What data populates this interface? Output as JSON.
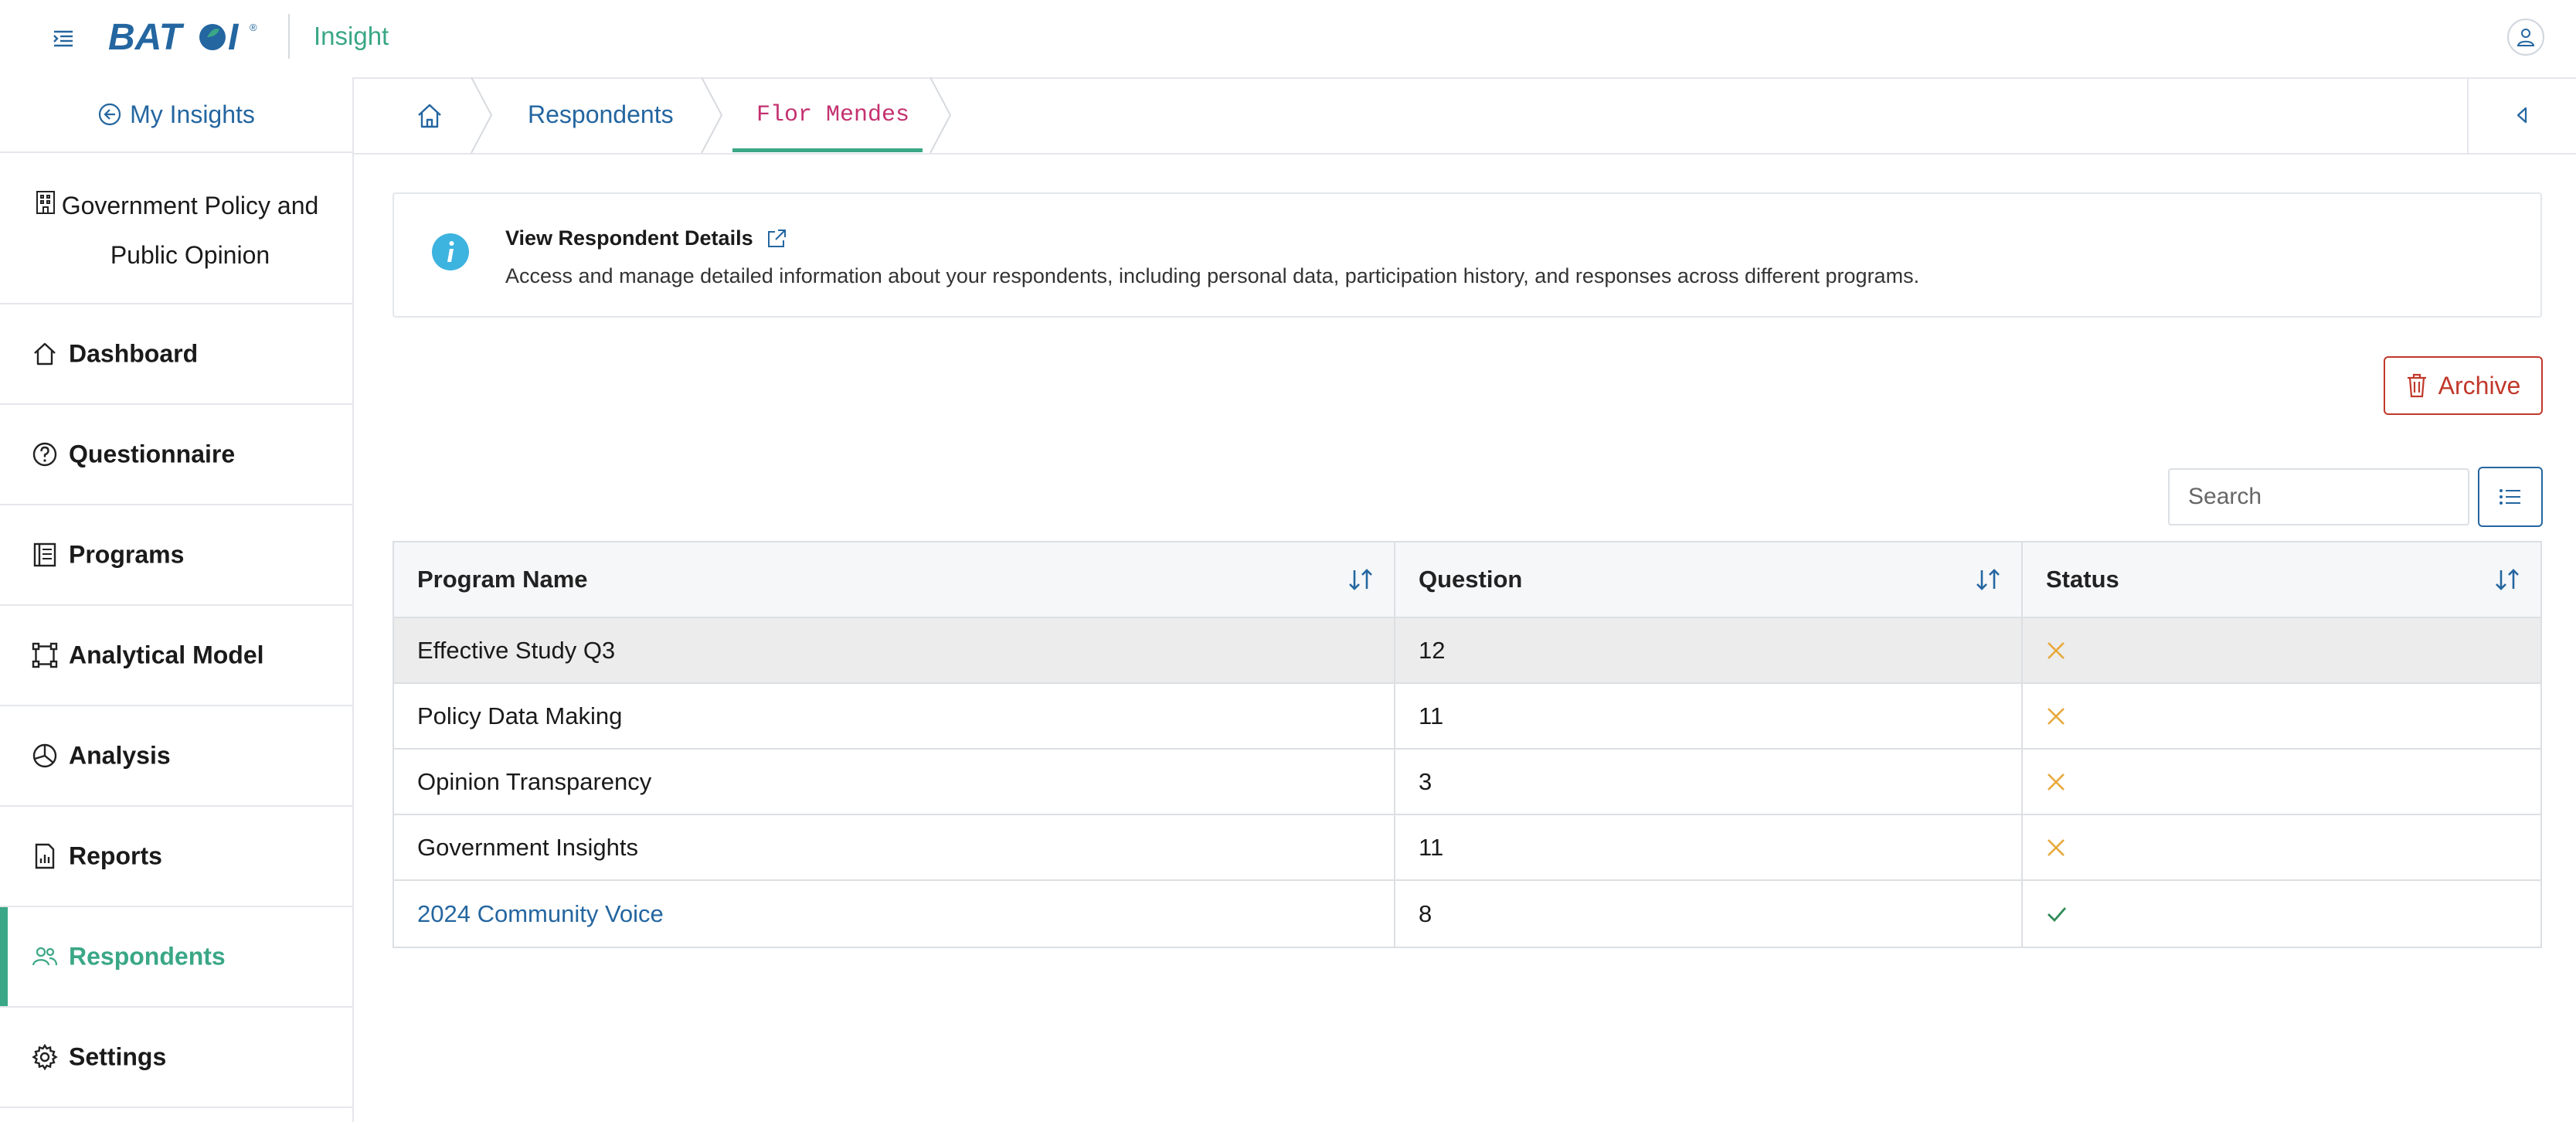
{
  "header": {
    "logo_text": "BATOI",
    "app_title": "Insight"
  },
  "sidebar": {
    "back_label": "My Insights",
    "project_title": "Government Policy and Public Opinion",
    "items": [
      {
        "label": "Dashboard",
        "icon": "home-icon"
      },
      {
        "label": "Questionnaire",
        "icon": "question-circle-icon"
      },
      {
        "label": "Programs",
        "icon": "book-icon"
      },
      {
        "label": "Analytical Model",
        "icon": "bounding-box-icon"
      },
      {
        "label": "Analysis",
        "icon": "pie-chart-icon"
      },
      {
        "label": "Reports",
        "icon": "report-icon"
      },
      {
        "label": "Respondents",
        "icon": "people-icon",
        "active": true
      },
      {
        "label": "Settings",
        "icon": "gear-icon"
      }
    ]
  },
  "breadcrumb": {
    "items": [
      "Respondents",
      "Flor Mendes"
    ]
  },
  "info": {
    "title": "View Respondent Details",
    "description": "Access and manage detailed information about your respondents, including personal data, participation history, and responses across different programs."
  },
  "actions": {
    "archive_label": "Archive"
  },
  "search": {
    "placeholder": "Search"
  },
  "table": {
    "columns": [
      "Program Name",
      "Question",
      "Status"
    ],
    "rows": [
      {
        "program": "Effective Study Q3",
        "question": "12",
        "status": "inactive"
      },
      {
        "program": "Policy Data Making",
        "question": "11",
        "status": "inactive"
      },
      {
        "program": "Opinion Transparency",
        "question": "3",
        "status": "inactive"
      },
      {
        "program": "Government Insights",
        "question": "11",
        "status": "inactive"
      },
      {
        "program": "2024 Community Voice",
        "question": "8",
        "status": "active"
      }
    ]
  },
  "colors": {
    "accent_green": "#3aa786",
    "link_blue": "#2466a0",
    "danger_red": "#c0392b",
    "status_inactive": "#e8a93b",
    "status_active": "#2e8b57",
    "info_icon": "#3db3e0"
  }
}
